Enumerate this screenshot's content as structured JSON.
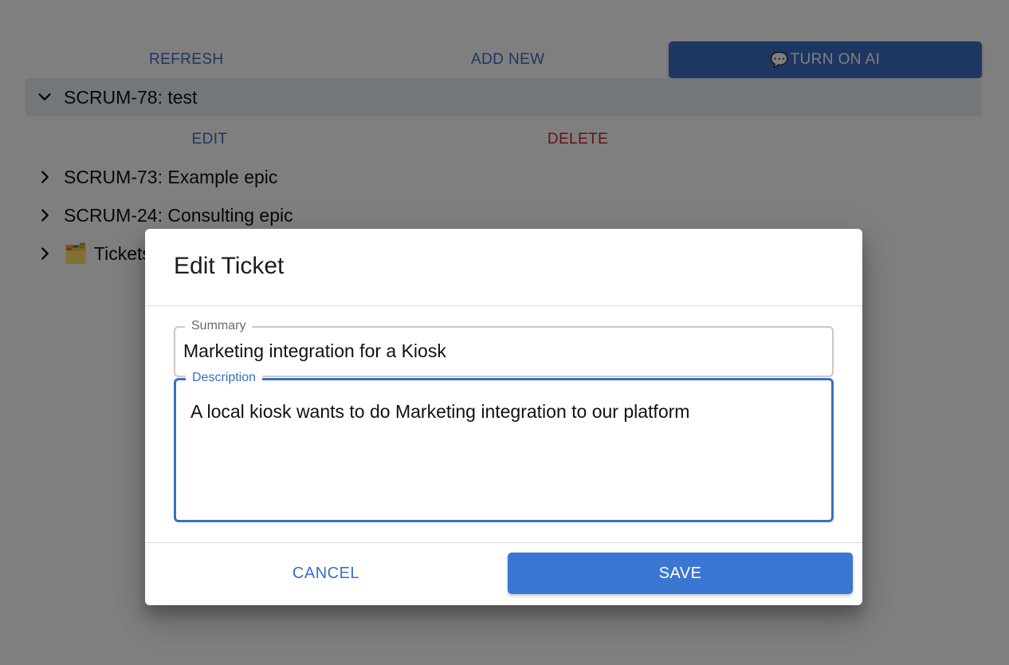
{
  "toolbar": {
    "refresh_label": "REFRESH",
    "add_new_label": "ADD NEW",
    "turn_on_ai_emoji": "💬",
    "turn_on_ai_label": "TURN ON AI"
  },
  "tree": {
    "items": [
      {
        "label": "SCRUM-78: test",
        "expanded": true
      },
      {
        "label": "SCRUM-73: Example epic",
        "expanded": false
      },
      {
        "label": "SCRUM-24: Consulting epic",
        "expanded": false
      },
      {
        "label": "Tickets",
        "expanded": false,
        "icon": "folder-icon",
        "emoji": "🗂️"
      }
    ],
    "selected_actions": {
      "edit_label": "EDIT",
      "delete_label": "DELETE"
    }
  },
  "dialog": {
    "title": "Edit Ticket",
    "summary": {
      "label": "Summary",
      "value": "Marketing integration for a Kiosk"
    },
    "description": {
      "label": "Description",
      "value": "A local kiosk wants to do Marketing integration to our platform"
    },
    "cancel_label": "CANCEL",
    "save_label": "SAVE"
  },
  "colors": {
    "primary": "#3a6fc4",
    "danger": "#c62828"
  }
}
